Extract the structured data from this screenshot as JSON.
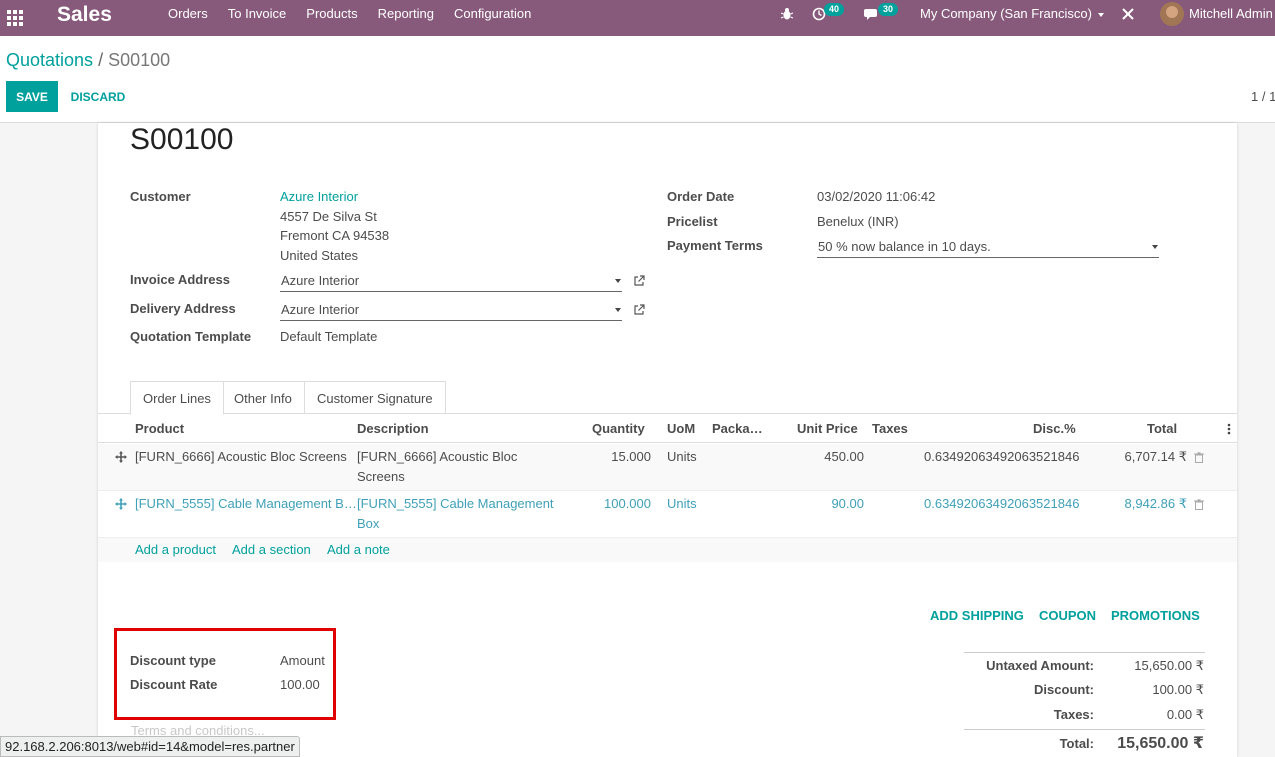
{
  "navbar": {
    "brand": "Sales",
    "menu": [
      "Orders",
      "To Invoice",
      "Products",
      "Reporting",
      "Configuration"
    ],
    "activity_count": "40",
    "message_count": "30",
    "company": "My Company (San Francisco)",
    "user": "Mitchell Admin"
  },
  "control": {
    "breadcrumb_parent": "Quotations",
    "breadcrumb_sep": "/",
    "breadcrumb_current": "S00100",
    "save_label": "SAVE",
    "discard_label": "DISCARD",
    "pager": "1 / 1"
  },
  "form": {
    "order_name": "S00100",
    "customer_label": "Customer",
    "customer_name": "Azure Interior",
    "customer_address": [
      "4557 De Silva St",
      "Fremont CA 94538",
      "United States"
    ],
    "invoice_address_label": "Invoice Address",
    "invoice_address": "Azure Interior",
    "delivery_address_label": "Delivery Address",
    "delivery_address": "Azure Interior",
    "template_label": "Quotation Template",
    "template": "Default Template",
    "order_date_label": "Order Date",
    "order_date": "03/02/2020 11:06:42",
    "pricelist_label": "Pricelist",
    "pricelist": "Benelux (INR)",
    "payment_terms_label": "Payment Terms",
    "payment_terms": "50 % now balance in 10 days."
  },
  "tabs": [
    "Order Lines",
    "Other Info",
    "Customer Signature"
  ],
  "table": {
    "headers": {
      "product": "Product",
      "description": "Description",
      "quantity": "Quantity",
      "uom": "UoM",
      "packaging": "Packa…",
      "unit_price": "Unit Price",
      "taxes": "Taxes",
      "discount": "Disc.%",
      "total": "Total"
    },
    "rows": [
      {
        "product": "[FURN_6666] Acoustic Bloc Screens",
        "description_1": "[FURN_6666] Acoustic Bloc",
        "description_2": "Screens",
        "quantity": "15.000",
        "uom": "Units",
        "unit_price": "450.00",
        "discount": "0.63492063492063521846",
        "total": "6,707.14 ₹"
      },
      {
        "product": "[FURN_5555] Cable Management B…",
        "description_1": "[FURN_5555] Cable Management",
        "description_2": "Box",
        "quantity": "100.000",
        "uom": "Units",
        "unit_price": "90.00",
        "discount": "0.63492063492063521846",
        "total": "8,942.86 ₹"
      }
    ],
    "add_product": "Add a product",
    "add_section": "Add a section",
    "add_note": "Add a note"
  },
  "actions": {
    "add_shipping": "ADD SHIPPING",
    "coupon": "COUPON",
    "promotions": "PROMOTIONS"
  },
  "discount": {
    "type_label": "Discount type",
    "type_value": "Amount",
    "rate_label": "Discount Rate",
    "rate_value": "100.00"
  },
  "totals": {
    "untaxed_label": "Untaxed Amount:",
    "untaxed_value": "15,650.00 ₹",
    "discount_label": "Discount:",
    "discount_value": "100.00 ₹",
    "taxes_label": "Taxes:",
    "taxes_value": "0.00 ₹",
    "total_label": "Total:",
    "total_value": "15,650.00 ₹"
  },
  "terms_placeholder": "Terms and conditions...",
  "status_url": "92.168.2.206:8013/web#id=14&model=res.partner",
  "colors": {
    "navbar": "#875a7b",
    "accent": "#00a09d",
    "highlight": "#e10000"
  }
}
